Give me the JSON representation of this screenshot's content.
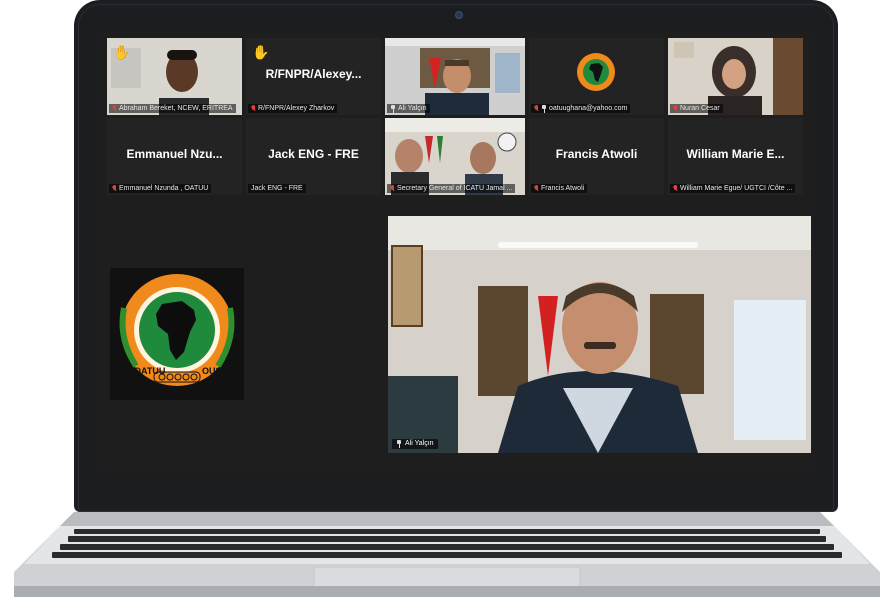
{
  "meeting": {
    "row1": [
      {
        "label": "Abraham Bereket, NCEW, ERITREA",
        "muted": true,
        "raised_hand": true
      },
      {
        "display_name": "R/FNPR/Alexey...",
        "label": "R/FNPR/Alexey Zharkov",
        "muted": true,
        "raised_hand": true
      },
      {
        "label": "Ali Yalçın",
        "pinned": true,
        "active_speaker": true
      },
      {
        "label": "oatuughana@yahoo.com",
        "muted": true,
        "pinned": true
      },
      {
        "label": "Nuran Cesar",
        "muted": true
      }
    ],
    "row2": [
      {
        "display_name": "Emmanuel Nzu...",
        "label": "Emmanuel Nzunda , OATUU",
        "muted": true
      },
      {
        "display_name": "Jack ENG - FRE",
        "label": "Jack ENG - FRE"
      },
      {
        "label": "Secretary General of ICATU Jamal ...",
        "muted": true
      },
      {
        "display_name": "Francis Atwoli",
        "label": "Francis Atwoli",
        "muted": true
      },
      {
        "display_name": "William Marie E...",
        "label": "William Marie Egue/ UGTCI /Côte ...",
        "muted": true
      }
    ],
    "logo": {
      "text_left": "OATUU",
      "text_right": "OUSA"
    },
    "spotlight": {
      "label": "Ali Yalçın",
      "pinned": true
    }
  },
  "colors": {
    "active_border": "#c8e86b",
    "mic_muted": "#e04040",
    "logo_orange": "#f08a1c",
    "logo_green": "#1f8a3c"
  }
}
